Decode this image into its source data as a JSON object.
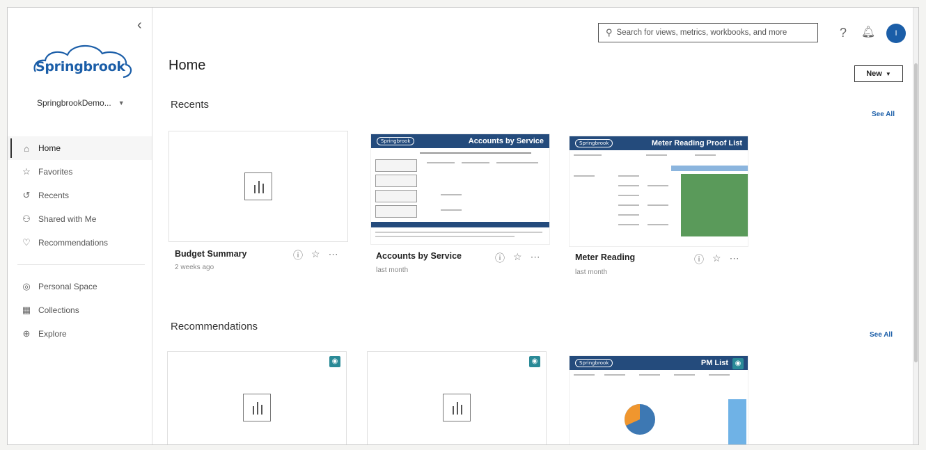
{
  "search": {
    "placeholder": "Search for views, metrics, workbooks, and more"
  },
  "user": {
    "initial": "I"
  },
  "sidebar": {
    "logo_text": "Springbrook",
    "site_name": "SpringbrookDemo...",
    "nav": [
      {
        "label": "Home",
        "icon": "home-icon"
      },
      {
        "label": "Favorites",
        "icon": "star-icon"
      },
      {
        "label": "Recents",
        "icon": "history-icon"
      },
      {
        "label": "Shared with Me",
        "icon": "shared-users-icon"
      },
      {
        "label": "Recommendations",
        "icon": "lightbulb-icon"
      }
    ],
    "nav2": [
      {
        "label": "Personal Space",
        "icon": "person-icon"
      },
      {
        "label": "Collections",
        "icon": "collections-icon"
      },
      {
        "label": "Explore",
        "icon": "compass-icon"
      }
    ]
  },
  "main": {
    "title": "Home",
    "new_label": "New",
    "recents": {
      "title": "Recents",
      "see_all": "See All",
      "items": [
        {
          "name": "Budget Summary",
          "time": "2 weeks ago"
        },
        {
          "name": "Accounts by Service",
          "time": "last month",
          "thumb_logo": "Springbrook",
          "thumb_title": "Accounts by Service"
        },
        {
          "name": "Meter Reading",
          "time": "last month",
          "thumb_logo": "Springbrook",
          "thumb_title": "Meter Reading Proof List"
        }
      ]
    },
    "recommendations": {
      "title": "Recommendations",
      "see_all": "See All",
      "items": [
        {},
        {},
        {
          "thumb_logo": "Springbrook",
          "thumb_title": "PM List"
        }
      ]
    }
  },
  "colors": {
    "accent": "#1b5ea8",
    "thumb_header": "#244b7c",
    "badge": "#2a8a97",
    "pie_blue": "#3d78b3",
    "pie_orange": "#f0962e"
  }
}
